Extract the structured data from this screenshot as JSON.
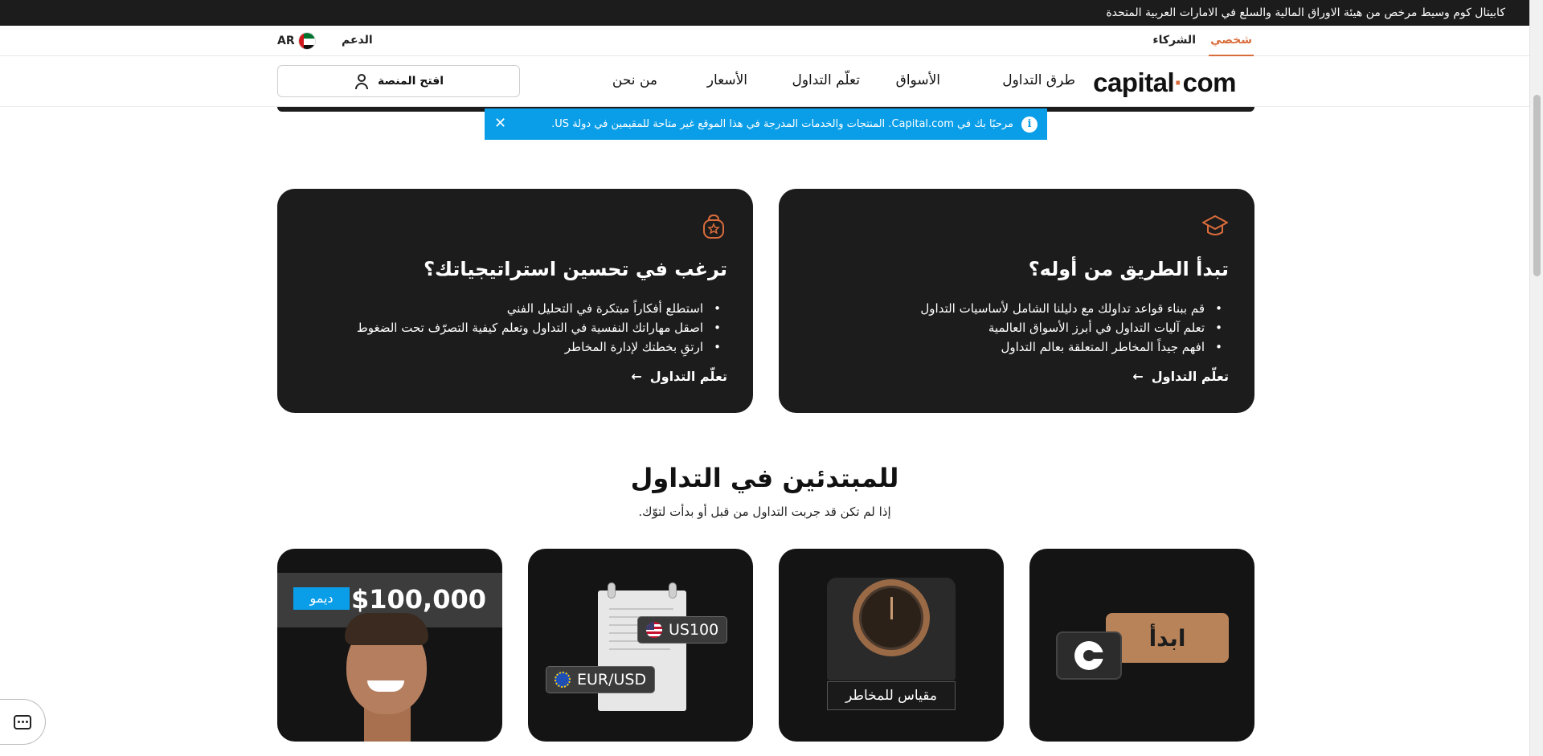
{
  "regulatory_bar": {
    "text": "كابيتال كوم وسيط مرخص من هيئة الاوراق المالية والسلع في الامارات العربية المتحدة"
  },
  "subnav": {
    "tab_personal": "شخصي",
    "tab_partners": "الشركاء",
    "support": "الدعم",
    "language": "AR"
  },
  "mainnav": {
    "logo_main": "capital",
    "logo_dot": "·",
    "logo_end": "com",
    "links": [
      "طرق التداول",
      "الأسواق",
      "تعلّم التداول",
      "الأسعار",
      "من نحن"
    ],
    "open_platform": "افتح المنصة"
  },
  "banner": {
    "text": "مرحبًا بك في Capital.com. المنتجات والخدمات المدرجة في هذا الموقع غير متاحة للمقيمين في دولة US.",
    "icon": "info-icon"
  },
  "cards": [
    {
      "icon": "graduation-cap-icon",
      "title": "تبدأ الطريق من أوله؟",
      "bullets": [
        "قم ببناء قواعد تداولك مع دليلنا الشامل لأساسيات التداول",
        "تعلم آليات التداول في أبرز الأسواق العالمية",
        "افهم جيداً المخاطر المتعلقة بعالم التداول"
      ],
      "link": "تعلّم التداول"
    },
    {
      "icon": "kettlebell-star-icon",
      "title": "ترغب في تحسين استراتيجياتك؟",
      "bullets": [
        "استطلع أفكاراً مبتكرة في التحليل الفني",
        "اصقل مهاراتك النفسية في التداول وتعلم كيفية التصرّف تحت الضغوط",
        "ارتقِ بخطتك لإدارة المخاطر"
      ],
      "link": "تعلّم التداول"
    }
  ],
  "beginners": {
    "title": "للمبتدئين في التداول",
    "subtitle": "إذا لم تكن قد جربت التداول من قبل أو بدأت لتوّك."
  },
  "tiles": {
    "start_label": "ابدأ",
    "risk_label": "مقياس للمخاطر",
    "ticker_us": "US100",
    "ticker_eu": "EUR/USD",
    "demo_badge": "ديمو",
    "demo_amount": "$100,000"
  },
  "colors": {
    "accent": "#d96c3b",
    "banner_blue": "#0a9ee8",
    "card_dark": "#1c1c1c"
  }
}
